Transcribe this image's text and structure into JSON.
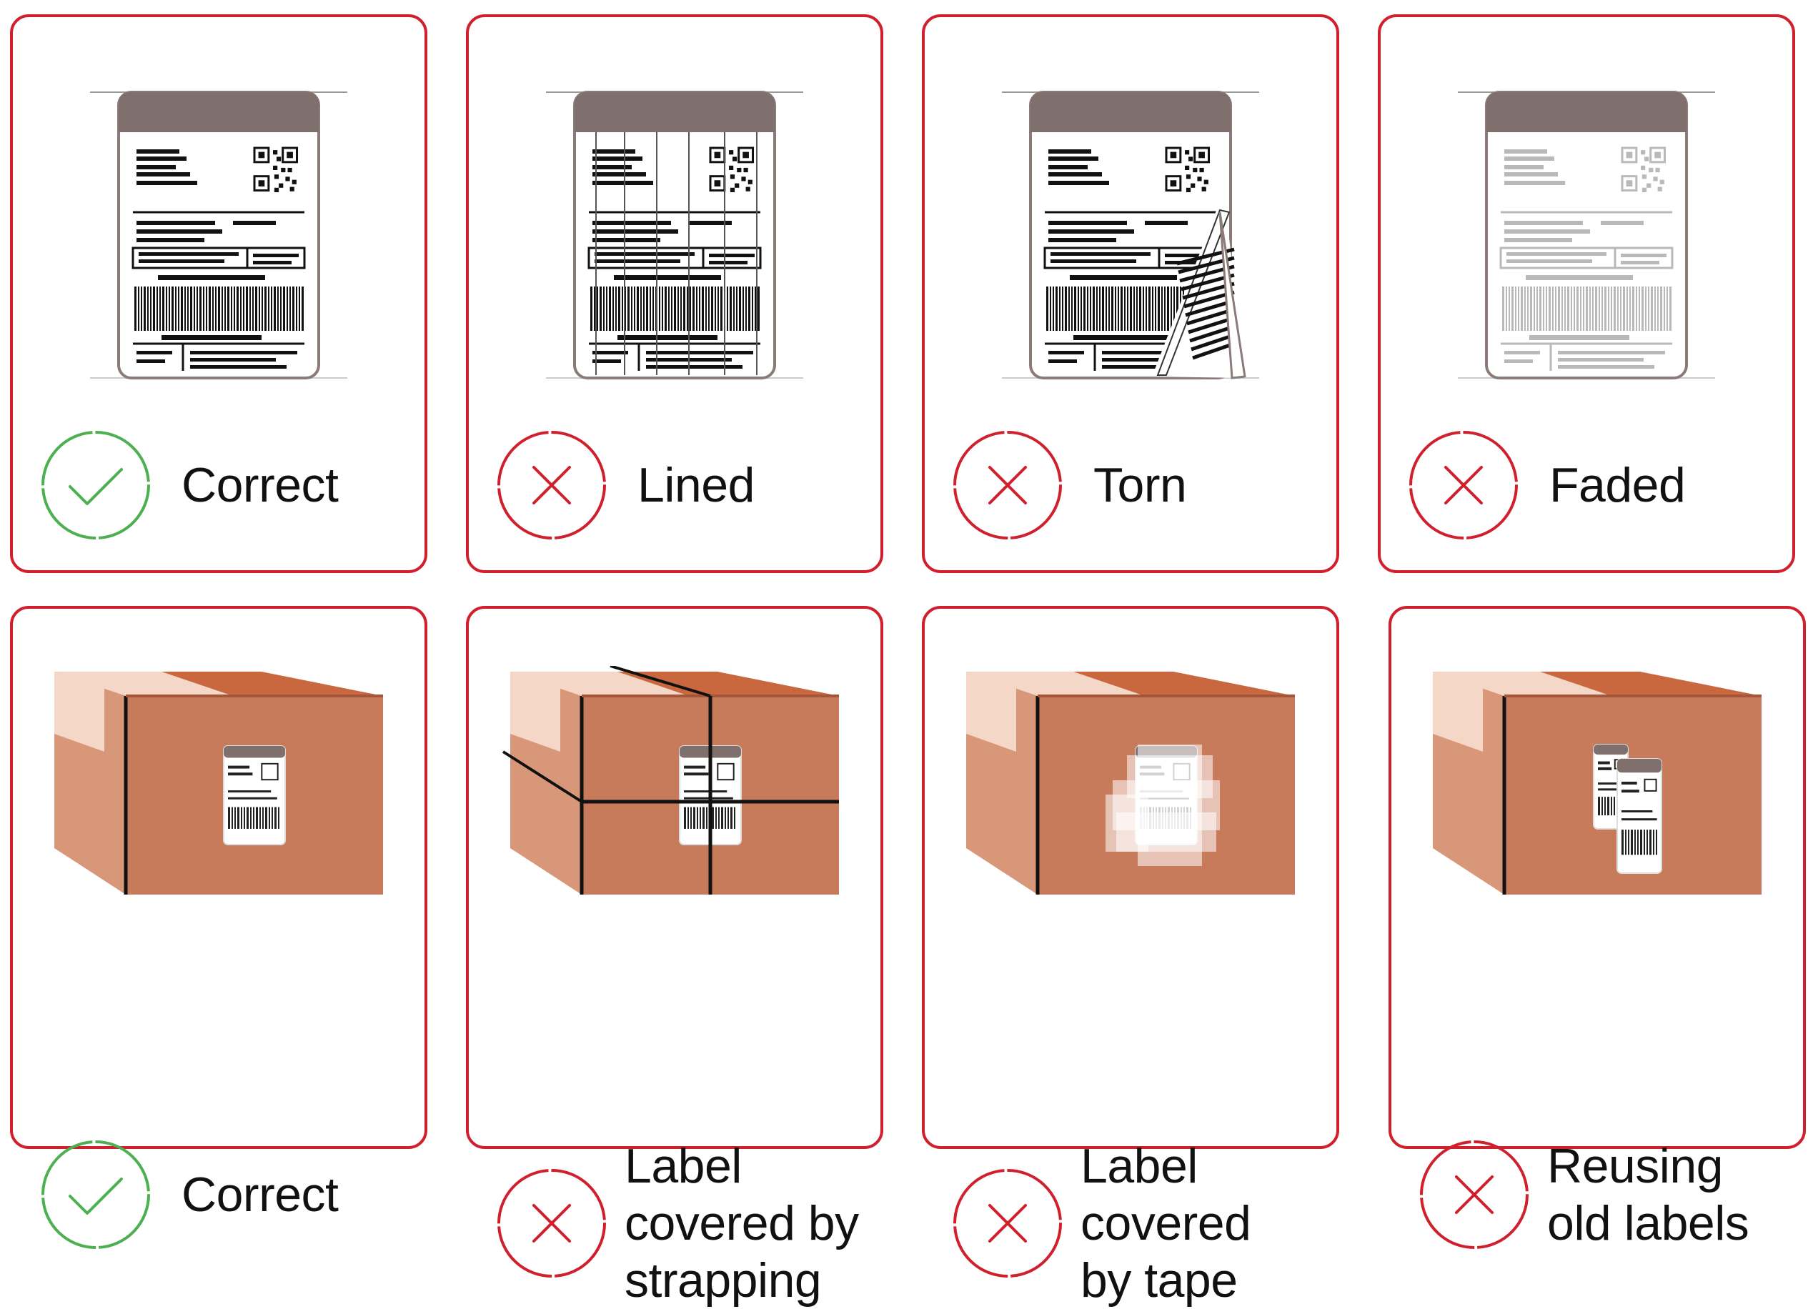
{
  "colors": {
    "border": "#d0202e",
    "correct": "#4caf50",
    "incorrect": "#d0202e"
  },
  "rows": [
    {
      "kind": "label",
      "cards": [
        {
          "label": "Correct",
          "status": "correct",
          "variant": "normal",
          "icon": "check-icon"
        },
        {
          "label": "Lined",
          "status": "incorrect",
          "variant": "lined",
          "icon": "x-icon"
        },
        {
          "label": "Torn",
          "status": "incorrect",
          "variant": "torn",
          "icon": "x-icon"
        },
        {
          "label": "Faded",
          "status": "incorrect",
          "variant": "faded",
          "icon": "x-icon"
        }
      ]
    },
    {
      "kind": "box",
      "cards": [
        {
          "label": "Correct",
          "status": "correct",
          "variant": "normal",
          "icon": "check-icon"
        },
        {
          "label": "Label\ncovered by\nstrapping",
          "status": "incorrect",
          "variant": "strapping",
          "icon": "x-icon"
        },
        {
          "label": "Label\ncovered\nby tape",
          "status": "incorrect",
          "variant": "tape",
          "icon": "x-icon"
        },
        {
          "label": "Reusing\nold labels",
          "status": "incorrect",
          "variant": "reused",
          "icon": "x-icon"
        }
      ]
    }
  ]
}
